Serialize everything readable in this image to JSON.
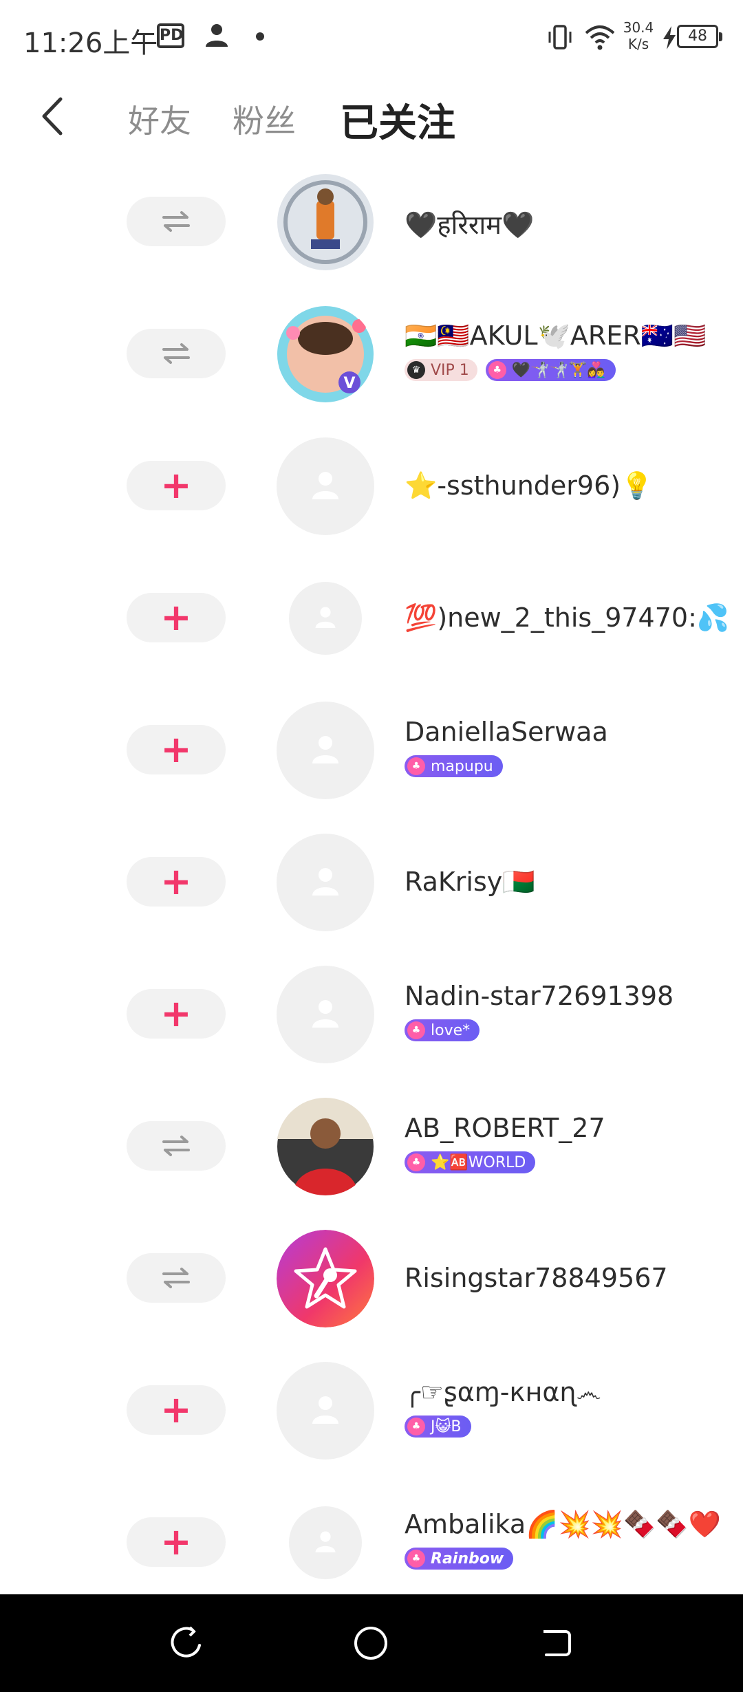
{
  "status_bar": {
    "time": "11:26上午",
    "pd_label": "PD",
    "speed_value": "30.4",
    "speed_unit": "K/s",
    "battery": "48"
  },
  "header": {
    "tabs": [
      {
        "label": "好友",
        "active": false
      },
      {
        "label": "粉丝",
        "active": false
      },
      {
        "label": "已关注",
        "active": true
      }
    ]
  },
  "colors": {
    "accent": "#f2376b",
    "badge_purple": "#7a5cf2",
    "button_bg": "#f2f2f2",
    "placeholder_bg": "#f0f0f0"
  },
  "users": [
    {
      "name": "🖤हरिराम🖤",
      "action": "mutual",
      "avatar": "photo",
      "badges": []
    },
    {
      "name": "🇮🇳🇲🇾AKUL🕊️ARER🇦🇺🇺🇸",
      "action": "mutual",
      "avatar": "photo",
      "badges": [
        {
          "type": "vip",
          "text": "VIP 1"
        },
        {
          "type": "fan",
          "text": "🖤🤺🤺🏋️👩‍❤️‍👨"
        }
      ]
    },
    {
      "name": "⭐-ssthunder96)💡",
      "action": "follow",
      "avatar": "placeholder-large",
      "badges": []
    },
    {
      "name": "💯)new_2_this_97470:💦",
      "action": "follow",
      "avatar": "placeholder-small",
      "badges": []
    },
    {
      "name": "DaniellaSerwaa",
      "action": "follow",
      "avatar": "placeholder-large",
      "badges": [
        {
          "type": "fan",
          "text": "mapupu"
        }
      ]
    },
    {
      "name": "RaKrisy🇲🇬",
      "action": "follow",
      "avatar": "placeholder-large",
      "badges": []
    },
    {
      "name": "Nadin-star72691398",
      "action": "follow",
      "avatar": "placeholder-large",
      "badges": [
        {
          "type": "fan",
          "text": "love*"
        }
      ]
    },
    {
      "name": "AB_ROBERT_27",
      "action": "mutual",
      "avatar": "photo",
      "badges": [
        {
          "type": "fan",
          "text": "⭐🆎WORLD"
        }
      ]
    },
    {
      "name": "Risingstar78849567",
      "action": "mutual",
      "avatar": "starmaker",
      "badges": []
    },
    {
      "name": "╭☞ʂαɱ-кнαɳ෴",
      "action": "follow",
      "avatar": "placeholder-large",
      "badges": [
        {
          "type": "fan",
          "text": "J😺B"
        }
      ]
    },
    {
      "name": "Ambalika🌈💥💥🍫🍫❤️",
      "action": "follow",
      "avatar": "placeholder-small",
      "badges": [
        {
          "type": "fan",
          "text": "Rainbow",
          "italic": true
        }
      ]
    }
  ]
}
